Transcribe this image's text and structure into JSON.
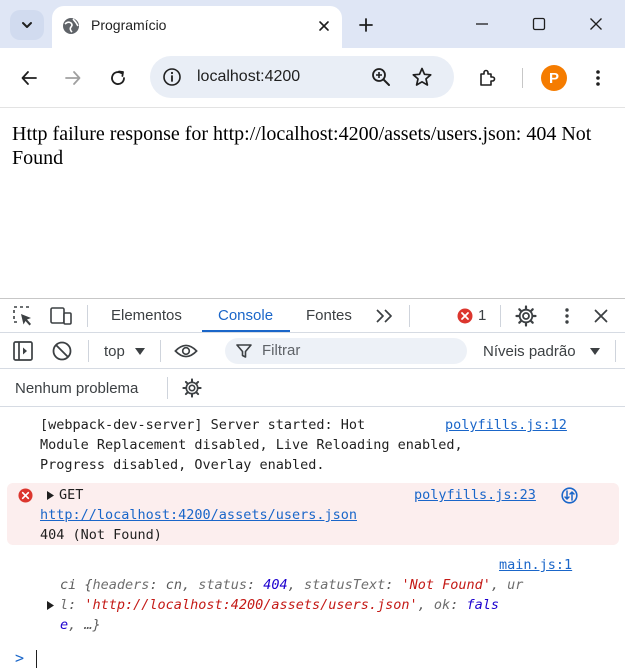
{
  "browser": {
    "tab_title": "Programício",
    "url": "localhost:4200",
    "profile_initial": "P",
    "colors": {
      "tabstrip": "#dfe6f5",
      "omnibox": "#e9eef6",
      "profile": "#f57c00"
    }
  },
  "page": {
    "error_message": "Http failure response for http://localhost:4200/assets/users.json: 404 Not Found"
  },
  "devtools": {
    "tabs": [
      {
        "label": "Elementos",
        "active": false
      },
      {
        "label": "Console",
        "active": true
      },
      {
        "label": "Fontes",
        "active": false
      }
    ],
    "more_tabs_icon": ">>",
    "error_count": "1",
    "context": "top",
    "filter_placeholder": "Filtrar",
    "levels": "Níveis padrão",
    "issues": "Nenhum problema",
    "accent": "#1a66c9",
    "console": {
      "messages": [
        {
          "lines": [
            "[webpack-dev-server] Server started: Hot",
            "Module Replacement disabled, Live Reloading enabled,",
            "Progress disabled, Overlay enabled."
          ],
          "source": "polyfills.js:12"
        },
        {
          "level": "error",
          "method": "GET",
          "url": "http://localhost:4200/assets/users.json",
          "status": "404 (Not Found)",
          "source": "polyfills.js:23"
        },
        {
          "source": "main.js:1",
          "object": {
            "class": "ci",
            "headers_key": "headers",
            "headers_val": "cn",
            "status_key": "status",
            "status_val": "404",
            "statusText_key": "statusText",
            "statusText_val": "'Not Found'",
            "url_key_part1": "ur",
            "url_key_part2": "l",
            "url_val": "'http://localhost:4200/assets/users.json'",
            "ok_key": "ok",
            "ok_val_part1": "fals",
            "ok_val_part2": "e",
            "ellipsis": "…}"
          }
        }
      ],
      "prompt": ">"
    }
  }
}
